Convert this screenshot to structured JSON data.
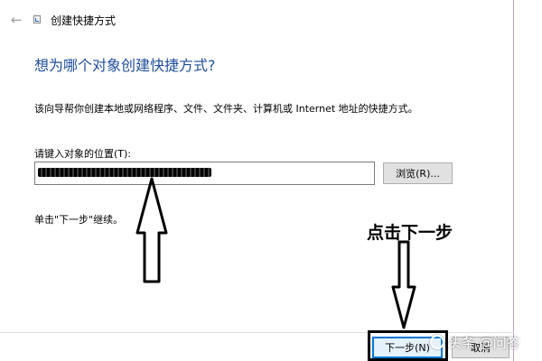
{
  "window": {
    "title": "创建快捷方式",
    "back_icon": "back-arrow-icon",
    "app_icon": "shortcut-wizard-icon"
  },
  "main": {
    "heading": "想为哪个对象创建快捷方式?",
    "description": "该向导帮你创建本地或网络程序、文件、文件夹、计算机或 Internet 地址的快捷方式。",
    "location_label": "请键入对象的位置(T):",
    "location_value": "",
    "browse_label": "浏览(R)...",
    "continue_hint": "单击\"下一步\"继续。"
  },
  "annotation": {
    "text": "点击下一步"
  },
  "footer": {
    "next_label": "下一步(N)",
    "cancel_label": "取消"
  },
  "watermark": {
    "text": "头条 @问答"
  },
  "colors": {
    "heading": "#1f4e9c",
    "focus_border": "#0078d7",
    "button_bg": "#e1e1e1",
    "frame_border": "#b9a2c6"
  }
}
